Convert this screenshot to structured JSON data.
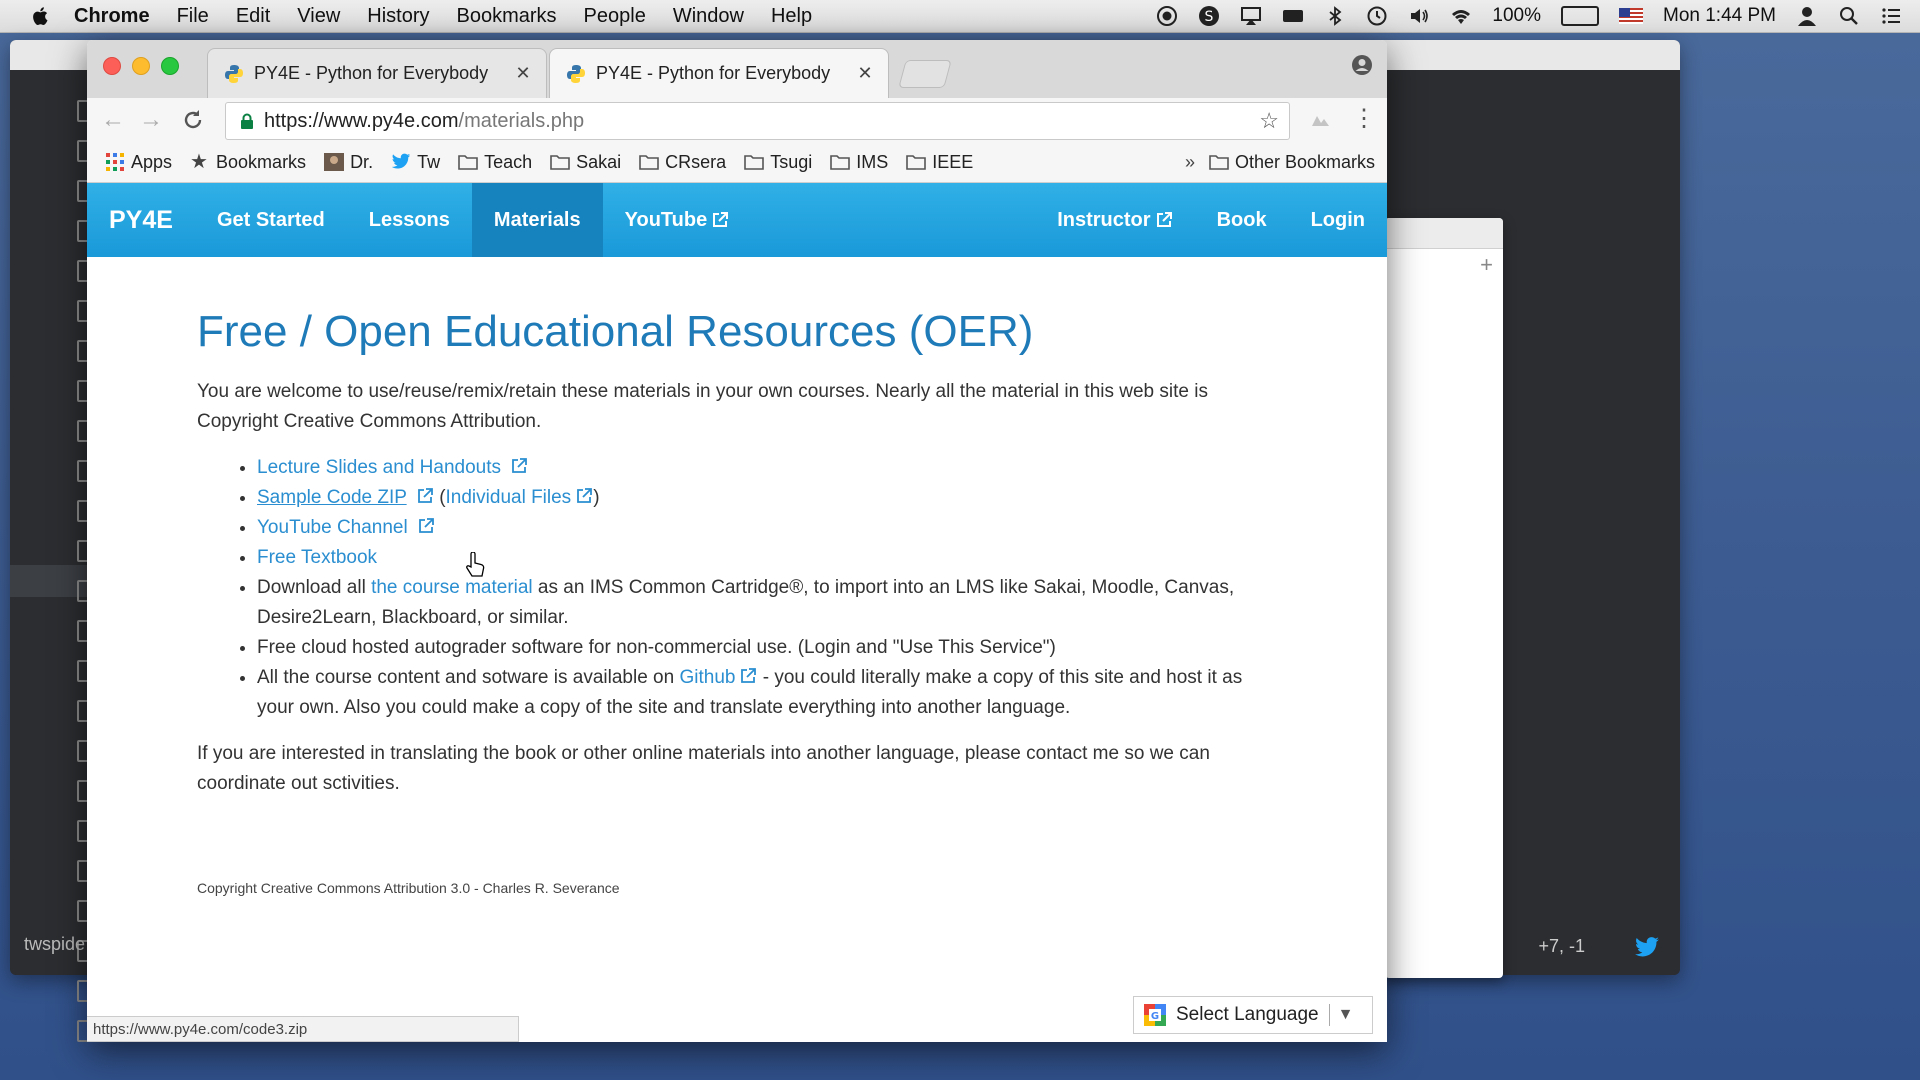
{
  "menubar": {
    "app": "Chrome",
    "items": [
      "File",
      "Edit",
      "View",
      "History",
      "Bookmarks",
      "People",
      "Window",
      "Help"
    ],
    "battery": "100%",
    "clock": "Mon 1:44 PM"
  },
  "bg_editor": {
    "file_label": "twspide",
    "position": "+7, -1"
  },
  "tabs": [
    {
      "label": "PY4E - Python for Everybody"
    },
    {
      "label": "PY4E - Python for Everybody"
    }
  ],
  "omnibox": {
    "host": "https://www.py4e.com",
    "path": "/materials.php"
  },
  "bookmarks": {
    "items": [
      "Apps",
      "Bookmarks",
      "Dr.",
      "Tw",
      "Teach",
      "Sakai",
      "CRsera",
      "Tsugi",
      "IMS",
      "IEEE"
    ],
    "other": "Other Bookmarks",
    "overflow": "»"
  },
  "site_nav": {
    "brand": "PY4E",
    "left": [
      "Get Started",
      "Lessons",
      "Materials",
      "YouTube"
    ],
    "right": [
      "Instructor",
      "Book",
      "Login"
    ]
  },
  "page": {
    "title": "Free / Open Educational Resources (OER)",
    "intro": "You are welcome to use/reuse/remix/retain these materials in your own courses. Nearly all the material in this web site is Copyright Creative Commons Attribution.",
    "links": {
      "slides": "Lecture Slides and Handouts",
      "zip": "Sample Code ZIP",
      "individual": "Individual Files",
      "youtube": "YouTube Channel",
      "textbook": "Free Textbook"
    },
    "download_pre": "Download all ",
    "download_link": "the course material",
    "download_post": " as an IMS Common Cartridge®, to import into an LMS like Sakai, Moodle, Canvas, Desire2Learn, Blackboard, or similar.",
    "autograder": "Free cloud hosted autograder software for non-commercial use. (Login and \"Use This Service\")",
    "github_pre": "All the course content and sotware is available on ",
    "github_link": "Github",
    "github_post": " - you could literally make a copy of this site and host it as your own. Also you could make a copy of the site and translate everything into another language.",
    "translate": "If you are interested in translating the book or other online materials into another language, please contact me so we can coordinate out sctivities.",
    "copyright": "Copyright Creative Commons Attribution 3.0 - Charles R. Severance"
  },
  "status_url": "https://www.py4e.com/code3.zip",
  "language_select": "Select Language",
  "colors": {
    "nav_bg": "#1a99d9",
    "nav_active": "#1682be",
    "link": "#2a8ed0",
    "heading": "#1f7ab8"
  }
}
